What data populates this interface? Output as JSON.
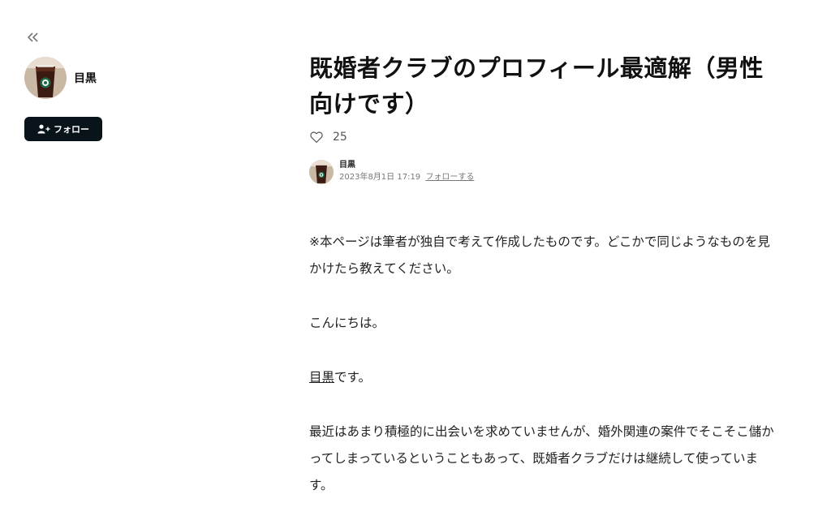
{
  "sidebar": {
    "back_icon": "double-chevron-left-icon",
    "creator_name": "目黒",
    "follow_label": "フォロー",
    "follow_icon": "user-plus-icon"
  },
  "article": {
    "title": "既婚者クラブのプロフィール最適解（男性向けです）",
    "like_icon": "heart-outline-icon",
    "like_count": "25",
    "author": {
      "name": "目黒",
      "datetime": "2023年8月1日 17:19",
      "follow_link": "フォローする"
    },
    "paragraphs": {
      "p1": "※本ページは筆者が独自で考えて作成したものです。どこかで同じようなものを見かけたら教えてください。",
      "p2": "こんにちは。",
      "p3_link": "目黒",
      "p3_rest": "です。",
      "p4": "最近はあまり積極的に出会いを求めていませんが、婚外関連の案件でそこそこ儲かってしまっているということもあって、既婚者クラブだけは継続して使っています。"
    }
  },
  "colors": {
    "follow_button_bg": "#08131a",
    "text": "#222222",
    "muted": "#777777"
  }
}
